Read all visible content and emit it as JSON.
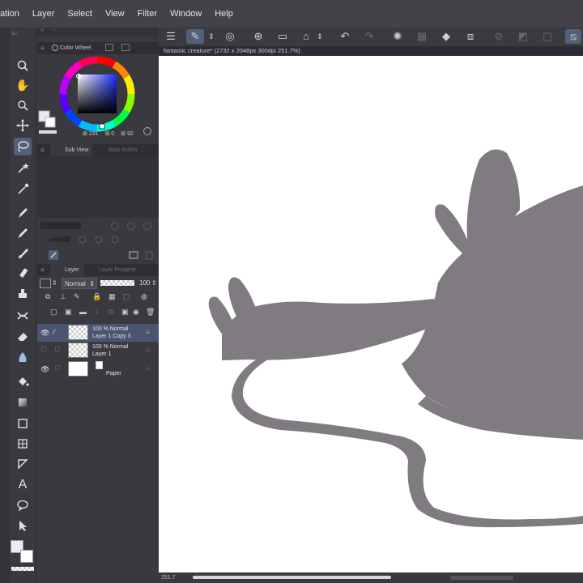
{
  "menubar": {
    "items": [
      "ation",
      "Layer",
      "Select",
      "View",
      "Filter",
      "Window",
      "Help"
    ]
  },
  "document": {
    "tab_title": "fantastic creature* (2732 x 2048px 300dpi 251.7%)",
    "zoom": "251.7"
  },
  "color_wheel": {
    "tab_label": "Color Wheel",
    "value_h": "231",
    "value_s": "0",
    "value_v": "92"
  },
  "sub_view": {
    "tab_label": "Sub View",
    "tab2_label": "Auto Action"
  },
  "layer_panel": {
    "tab_label": "Layer",
    "tab2_label": "Layer Property",
    "blend_mode": "Normal",
    "opacity": "100",
    "layers": [
      {
        "line1": "100 % Normal",
        "line2": "Layer 1 Copy 3"
      },
      {
        "line1": "100 % Normal",
        "line2": "Layer 1"
      },
      {
        "line1": "",
        "line2": "Paper"
      }
    ]
  },
  "colors": {
    "accent": "#52617a",
    "silhouette": "#7f7b80",
    "canvas": "#ffffff",
    "chrome": "#3a3940"
  },
  "icons": {
    "tools": [
      "zoom-icon",
      "hand-icon",
      "rotate-icon",
      "move-icon",
      "lasso-icon",
      "magic-wand-icon",
      "eyedropper-icon",
      "pen-icon",
      "pencil-icon",
      "brush-icon",
      "airbrush-icon",
      "decoration-icon",
      "eraser-icon",
      "blend-icon",
      "fill-icon",
      "gradient-icon",
      "figure-icon",
      "frame-icon",
      "ruler-icon",
      "text-icon",
      "balloon-icon",
      "correct-line-icon"
    ]
  }
}
